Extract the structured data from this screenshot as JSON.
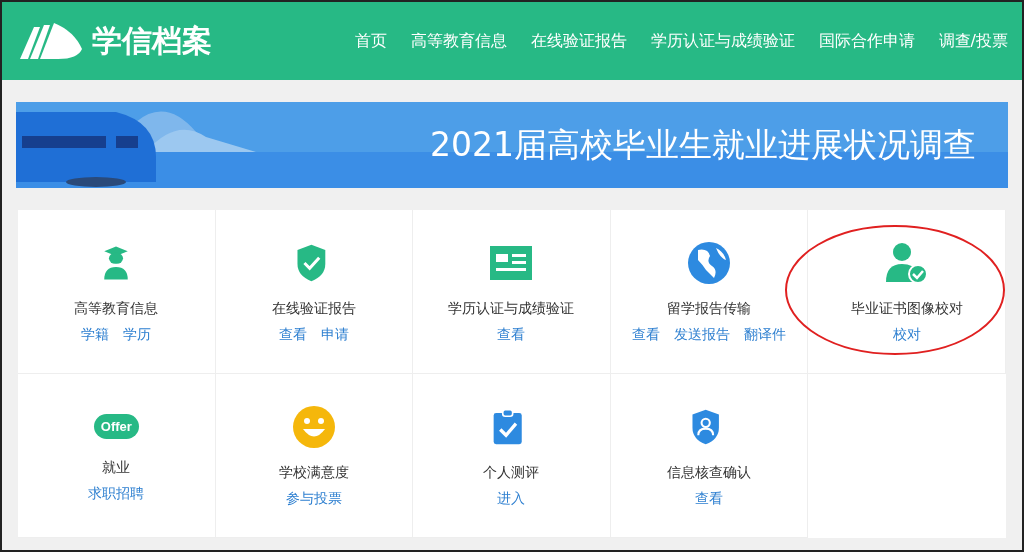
{
  "header": {
    "logo": "学信档案",
    "nav": [
      "首页",
      "高等教育信息",
      "在线验证报告",
      "学历认证与成绩验证",
      "国际合作申请",
      "调查/投票"
    ]
  },
  "banner": {
    "title": "2021届高校毕业生就业进展状况调查"
  },
  "services": [
    {
      "kind": "graduate",
      "title": "高等教育信息",
      "links": [
        "学籍",
        "学历"
      ],
      "highlighted": false
    },
    {
      "kind": "shield",
      "title": "在线验证报告",
      "links": [
        "查看",
        "申请"
      ],
      "highlighted": false
    },
    {
      "kind": "card",
      "title": "学历认证与成绩验证",
      "links": [
        "查看"
      ],
      "highlighted": false
    },
    {
      "kind": "globe",
      "title": "留学报告传输",
      "links": [
        "查看",
        "发送报告",
        "翻译件"
      ],
      "highlighted": false
    },
    {
      "kind": "user",
      "title": "毕业证书图像校对",
      "links": [
        "校对"
      ],
      "highlighted": true
    },
    {
      "kind": "badge",
      "badge": "Offer",
      "title": "就业",
      "links": [
        "求职招聘"
      ],
      "highlighted": false
    },
    {
      "kind": "smiley",
      "title": "学校满意度",
      "links": [
        "参与投票"
      ],
      "highlighted": false
    },
    {
      "kind": "clipboard",
      "title": "个人测评",
      "links": [
        "进入"
      ],
      "highlighted": false
    },
    {
      "kind": "badge-user",
      "title": "信息核查确认",
      "links": [
        "查看"
      ],
      "highlighted": false
    }
  ]
}
